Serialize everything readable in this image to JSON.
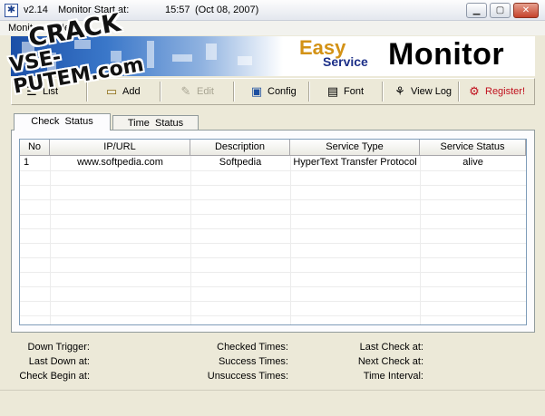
{
  "window": {
    "version": "v2.14",
    "start_label": "Monitor Start at:",
    "start_time": "15:57",
    "start_date": "(Oct 08, 2007)",
    "icons": [
      "app-star-icon",
      "minimize-icon",
      "maximize-icon",
      "close-icon"
    ]
  },
  "menu": {
    "items": [
      {
        "label": "Monitor"
      },
      {
        "label": "Help"
      }
    ]
  },
  "banner": {
    "easy": "Easy",
    "service": "Service",
    "monitor": "Monitor"
  },
  "watermark": {
    "line1": "CRACK",
    "line2": "VSE-PUTEM.com"
  },
  "toolbar": {
    "buttons": [
      {
        "label": "List",
        "icon": "list-icon",
        "enabled": true
      },
      {
        "label": "Add",
        "icon": "add-icon",
        "enabled": true
      },
      {
        "label": "Edit",
        "icon": "edit-icon",
        "enabled": false
      },
      {
        "label": "Config",
        "icon": "config-icon",
        "enabled": true
      },
      {
        "label": "Font",
        "icon": "font-icon",
        "enabled": true
      },
      {
        "label": "View Log",
        "icon": "view-log-icon",
        "enabled": true
      },
      {
        "label": "Register!",
        "icon": "register-icon",
        "enabled": true
      }
    ]
  },
  "tabs": [
    {
      "label": "Check  Status",
      "active": true
    },
    {
      "label": "Time  Status",
      "active": false
    }
  ],
  "table": {
    "columns": [
      "No",
      "IP/URL",
      "Description",
      "Service Type",
      "Service Status"
    ],
    "rows": [
      {
        "no": "1",
        "url": "www.softpedia.com",
        "description": "Softpedia",
        "service_type": "HyperText Transfer Protocol",
        "status": "alive"
      }
    ]
  },
  "info": {
    "down_trigger": "Down Trigger:",
    "last_down": "Last Down at:",
    "check_begin": "Check Begin at:",
    "checked_times": "Checked Times:",
    "success_times": "Success Times:",
    "unsuccess_times": "Unsuccess Times:",
    "last_check": "Last Check at:",
    "next_check": "Next Check at:",
    "time_interval": "Time Interval:"
  },
  "colors": {
    "register": "#c0101d",
    "easy": "#d39216",
    "service": "#1c2f88"
  }
}
